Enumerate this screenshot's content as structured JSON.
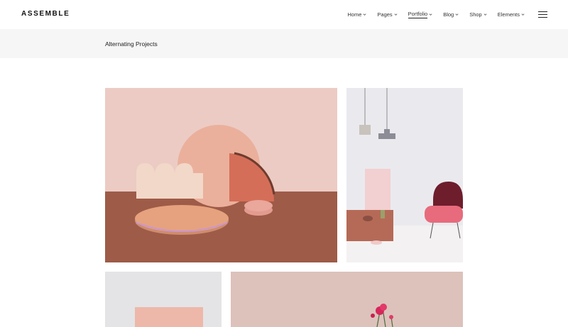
{
  "header": {
    "logo": "ASSEMBLE",
    "nav": [
      {
        "label": "Home"
      },
      {
        "label": "Pages"
      },
      {
        "label": "Portfolio"
      },
      {
        "label": "Blog"
      },
      {
        "label": "Shop"
      },
      {
        "label": "Elements"
      }
    ]
  },
  "titlebar": {
    "title": "Alternating Projects"
  },
  "colors": {
    "titlebar_bg": "#f6f6f6",
    "accent_pink": "#e9a796",
    "terracotta": "#9e5b48"
  },
  "projects": [
    {
      "name": "pink-still-life-shapes"
    },
    {
      "name": "pendant-lamps-pink-chair"
    },
    {
      "name": "pink-board-white-wall"
    },
    {
      "name": "pink-flowers-vase"
    }
  ]
}
